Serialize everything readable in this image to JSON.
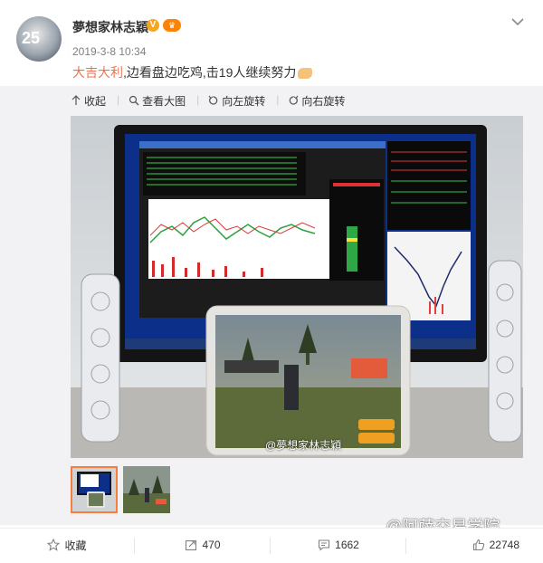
{
  "post": {
    "username": "夢想家林志穎",
    "verified_badge": "V",
    "vip_badge": "👑",
    "timestamp": "2019-3-8 10:34",
    "text_highlight": "大吉大利",
    "text_rest": ",边看盘边吃鸡,击19人继续努力"
  },
  "media_toolbar": {
    "collapse": "收起",
    "view_large": "查看大图",
    "rotate_left": "向左旋转",
    "rotate_right": "向右旋转"
  },
  "photo": {
    "watermark": "@夢想家林志穎"
  },
  "actions": {
    "collect": "收藏",
    "repost_count": "470",
    "comment_count": "1662",
    "like_count": "22748"
  },
  "page_watermark": "@阿萨交易学院",
  "colors": {
    "highlight": "#eb7350",
    "thumb_selected": "#fa7d3c",
    "badge": "#f5a623"
  }
}
